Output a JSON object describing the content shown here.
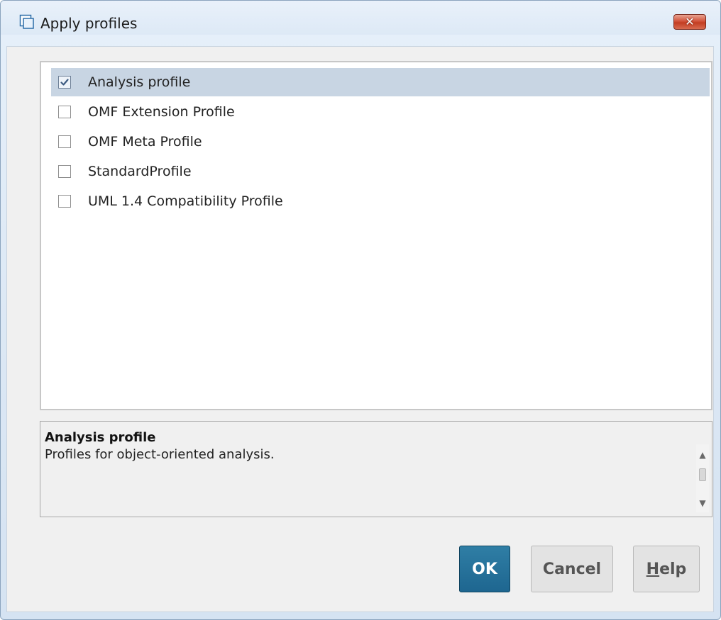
{
  "window": {
    "title": "Apply profiles",
    "title_icon": "window-icon",
    "close_label": "✕"
  },
  "profiles": [
    {
      "label": "Analysis profile",
      "checked": true,
      "selected": true
    },
    {
      "label": "OMF Extension Profile",
      "checked": false,
      "selected": false
    },
    {
      "label": "OMF Meta Profile",
      "checked": false,
      "selected": false
    },
    {
      "label": "StandardProfile",
      "checked": false,
      "selected": false
    },
    {
      "label": "UML 1.4 Compatibility Profile",
      "checked": false,
      "selected": false
    }
  ],
  "description": {
    "title": "Analysis profile",
    "text": "Profiles for object-oriented analysis."
  },
  "buttons": {
    "ok": "OK",
    "cancel": "Cancel",
    "help_mnemonic": "H",
    "help_rest": "elp"
  },
  "colors": {
    "ok_button": "#1e6690",
    "selected_row": "#c8d5e3",
    "close_button": "#c33d22"
  }
}
